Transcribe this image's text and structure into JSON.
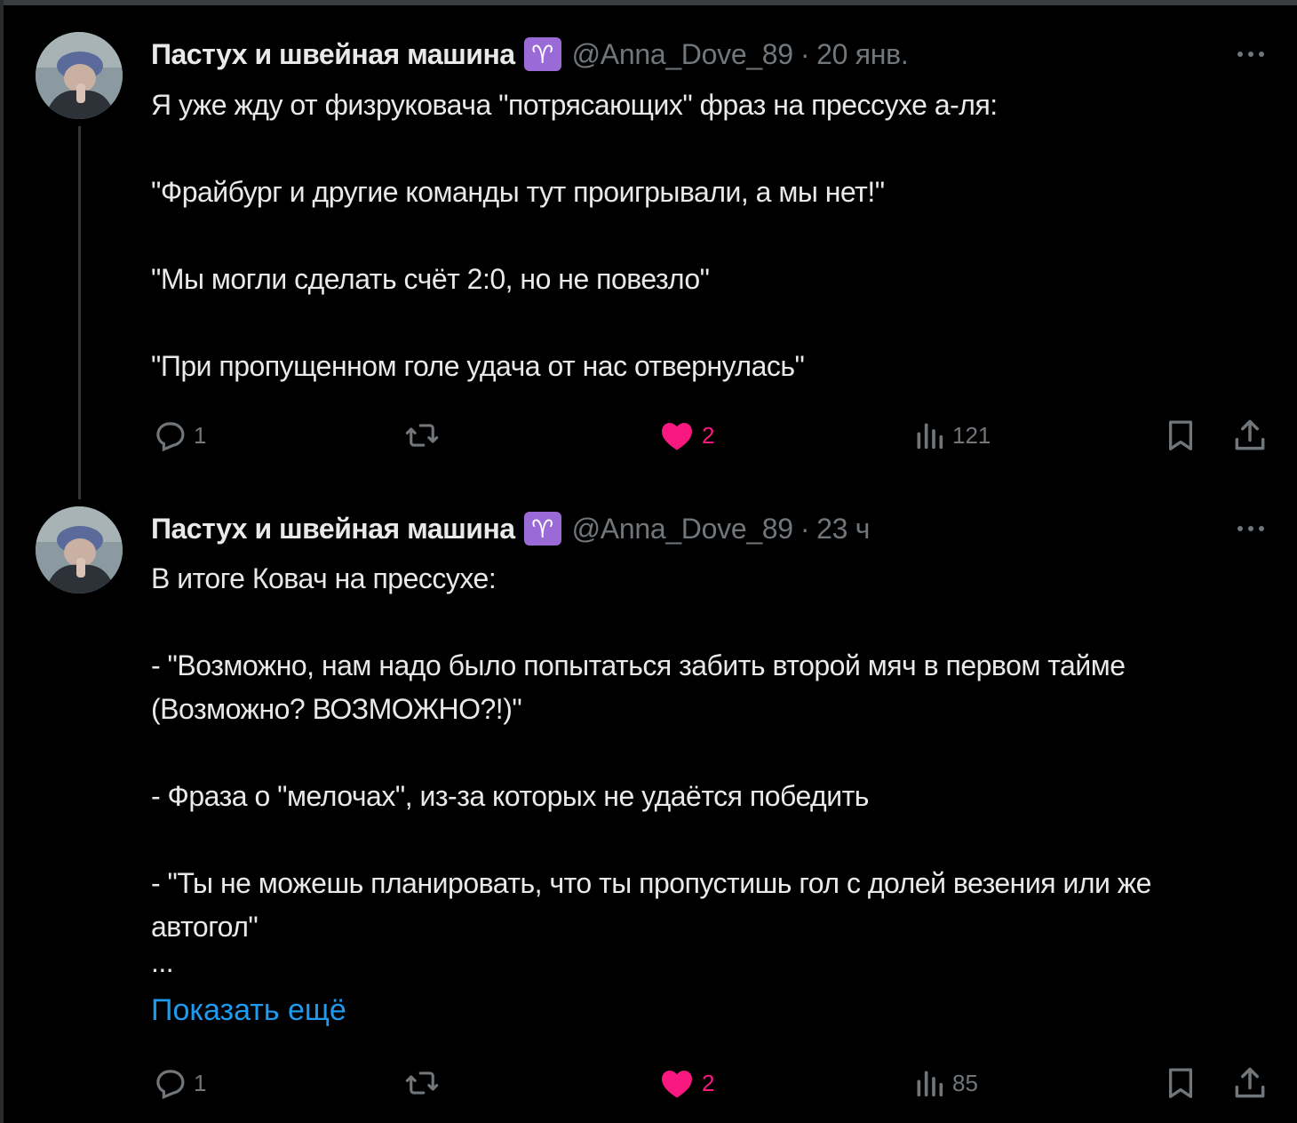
{
  "colors": {
    "background": "#000000",
    "text": "#e7e9ea",
    "muted": "#71767b",
    "like": "#f91880",
    "link": "#1d9bf0",
    "badge": "#9a6ad6"
  },
  "tweets": [
    {
      "author": {
        "display_name": "Пастух и швейная машина",
        "badge": "♈",
        "handle": "@Anna_Dove_89"
      },
      "separator": "·",
      "time": "20 янв.",
      "paragraphs": [
        "Я уже жду от физруковача \"потрясающих\" фраз на прессухе а-ля:",
        "\"Фрайбург и другие команды тут проигрывали, а мы нет!\"",
        "\"Мы могли сделать счёт 2:0, но не повезло\"",
        "\"При пропущенном голе удача от нас отвернулась\""
      ],
      "stats": {
        "replies": "1",
        "reposts": "",
        "likes": "2",
        "views": "121"
      },
      "icons": [
        "reply-icon",
        "repost-icon",
        "heart-icon",
        "views-icon",
        "bookmark-icon",
        "share-icon"
      ]
    },
    {
      "author": {
        "display_name": "Пастух и швейная машина",
        "badge": "♈",
        "handle": "@Anna_Dove_89"
      },
      "separator": "·",
      "time": "23 ч",
      "paragraphs": [
        "В итоге Ковач на прессухе:",
        "- \"Возможно, нам надо было попытаться забить второй мяч в первом тайме (Возможно? ВОЗМОЖНО?!)\"",
        "- Фраза о \"мелочах\", из-за которых не удаётся победить",
        "- \"Ты не можешь планировать, что ты пропустишь гол с долей везения или же автогол\"",
        "..."
      ],
      "show_more": "Показать ещё",
      "stats": {
        "replies": "1",
        "reposts": "",
        "likes": "2",
        "views": "85"
      },
      "icons": [
        "reply-icon",
        "repost-icon",
        "heart-icon",
        "views-icon",
        "bookmark-icon",
        "share-icon"
      ]
    }
  ]
}
